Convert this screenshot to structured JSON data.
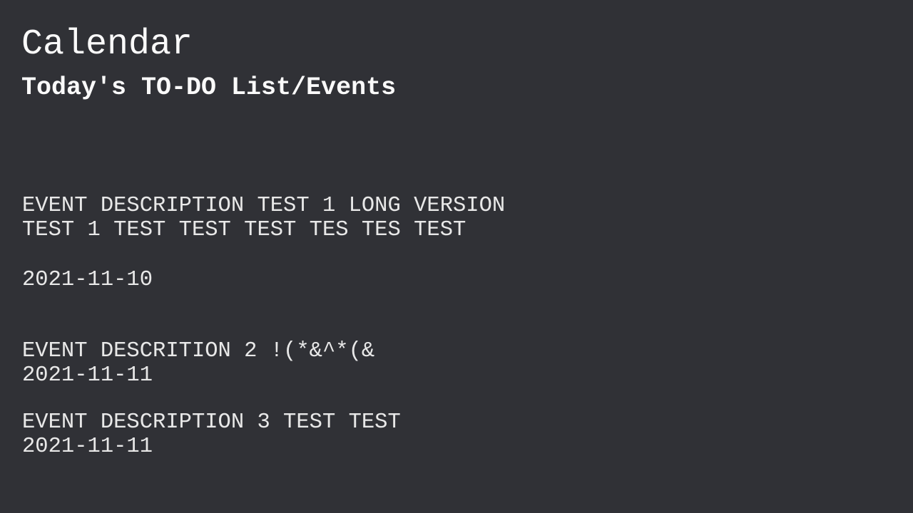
{
  "header": {
    "title": "Calendar",
    "subtitle": "Today's TO-DO List/Events"
  },
  "events": [
    {
      "description": "EVENT DESCRIPTION TEST 1 LONG VERSION TEST 1 TEST TEST TEST TES TES TEST",
      "date": "2021-11-10"
    },
    {
      "description": "EVENT DESCRITION 2 !(*&^*(&",
      "date": "2021-11-11"
    },
    {
      "description": "EVENT DESCRIPTION 3 TEST TEST",
      "date": "2021-11-11"
    }
  ],
  "colors": {
    "background": "#303136",
    "text": "#f2f2f2"
  }
}
